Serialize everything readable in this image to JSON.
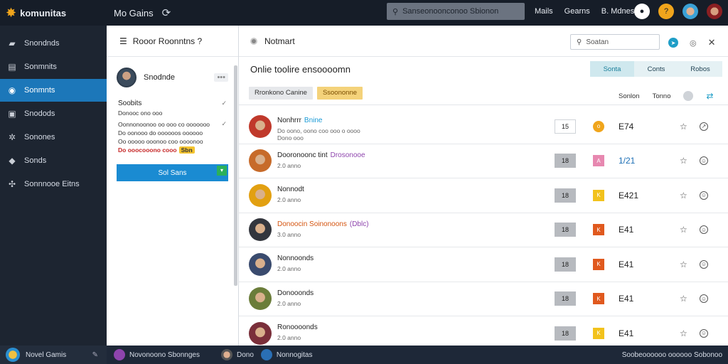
{
  "topbar": {
    "brand": "komunitas",
    "title": "Mo Gains",
    "search_placeholder": "Sanseonoonconoo Sbionon",
    "links": [
      "Mails",
      "Gearns",
      "B. Mdnes"
    ]
  },
  "sidebar": {
    "items": [
      {
        "label": "Snondnds",
        "icon": "folder-icon",
        "active": false
      },
      {
        "label": "Sonmnits",
        "icon": "list-icon",
        "active": false
      },
      {
        "label": "Sonmnts",
        "icon": "chat-icon",
        "active": true
      },
      {
        "label": "Snodods",
        "icon": "inbox-icon",
        "active": false
      },
      {
        "label": "Sonones",
        "icon": "gear-icon",
        "active": false
      },
      {
        "label": "Sonds",
        "icon": "tag-icon",
        "active": false
      },
      {
        "label": "Sonnnooe Eitns",
        "icon": "puzzle-icon",
        "active": false
      }
    ]
  },
  "mid": {
    "header": "Rooor Roonntns ?",
    "user_name": "Snodnde",
    "more": "•••",
    "section_title": "Soobits",
    "section_sub": "Donooc ono ooo",
    "desc": [
      "Oonnonoonoo oo ooo co ooooooo",
      "Do oonooo do oooooos oooooo",
      "Oo ooooo ooonoo coo oooonoo"
    ],
    "alert": "Do ooocooono cooo",
    "alert_badge": "Sbn",
    "button": "Sol Sans"
  },
  "main": {
    "header": "Notmart",
    "search_placeholder": "Soatan",
    "subheader": "Onlie toolire ensoooomn",
    "tabs": [
      {
        "label": "Sonta",
        "active": true
      },
      {
        "label": "Conts",
        "active": false
      },
      {
        "label": "Robos",
        "active": false
      }
    ],
    "filters": [
      {
        "label": "Rronkono Canine",
        "style": "grey"
      },
      {
        "label": "Ssoononne",
        "style": "yellow"
      }
    ],
    "sort_labels": [
      "Sonlon",
      "Tonno"
    ],
    "rows": [
      {
        "name": "Nonhrrr",
        "tag": "Bnine",
        "sub": "Do oono, oono coo ooo o oooo",
        "sub2": "Dono ooo",
        "count": "15",
        "count_style": "white",
        "mark": "o",
        "mark_color": "#f0a51c",
        "mark_round": true,
        "score": "E74",
        "score_style": "normal",
        "action": "↗",
        "avatar_color": "#c0392b"
      },
      {
        "name": "Dooronoonc tint",
        "tag": "Drosonooe",
        "tag_style": "purple",
        "sub": "2.0 anno",
        "count": "18",
        "count_style": "grey",
        "mark": "A",
        "mark_color": "#e788b0",
        "score": "1/21",
        "score_style": "blue",
        "action": "☺",
        "avatar_color": "#c76b2a"
      },
      {
        "name": "Nonnodt",
        "sub": "2.0 anno",
        "count": "18",
        "count_style": "grey",
        "mark": "K",
        "mark_color": "#f2c21c",
        "score": "E421",
        "score_style": "normal",
        "action": "☺",
        "avatar_color": "#e2a011"
      },
      {
        "name": "Donoocin Soinonoons",
        "tag": "(Dblc)",
        "tag_style": "purple",
        "name_style": "orange",
        "sub": "3.0 anno",
        "count": "18",
        "count_style": "grey",
        "mark": "K",
        "mark_color": "#e0591e",
        "score": "E41",
        "score_style": "normal",
        "action": "☺",
        "avatar_color": "#33363d"
      },
      {
        "name": "Nonnoonds",
        "sub": "2.0 anno",
        "count": "18",
        "count_style": "grey",
        "mark": "K",
        "mark_color": "#e0591e",
        "score": "E41",
        "score_style": "normal",
        "action": "☺",
        "avatar_color": "#3a4b6e"
      },
      {
        "name": "Donooonds",
        "sub": "2.0 anno",
        "count": "18",
        "count_style": "grey",
        "mark": "K",
        "mark_color": "#e0591e",
        "score": "E41",
        "score_style": "normal",
        "action": "☺",
        "avatar_color": "#6b7d3a"
      },
      {
        "name": "Ronoooonds",
        "sub": "2.0 anno",
        "count": "18",
        "count_style": "grey",
        "mark": "K",
        "mark_color": "#f2c21c",
        "score": "E41",
        "score_style": "normal",
        "action": "☺",
        "avatar_color": "#7a2f3a"
      }
    ]
  },
  "bottombar": {
    "left_label": "Novel Gamis",
    "items": [
      "Novonoono Sbonnges",
      "Dono",
      "Nonnogitas"
    ],
    "right_label": "Soobeoooooo oooooo Sobonoo"
  },
  "colors": {
    "accent": "#1c77b9",
    "topbar": "#161d28",
    "sidebar": "#1d2531",
    "button": "#1a8bd2"
  }
}
